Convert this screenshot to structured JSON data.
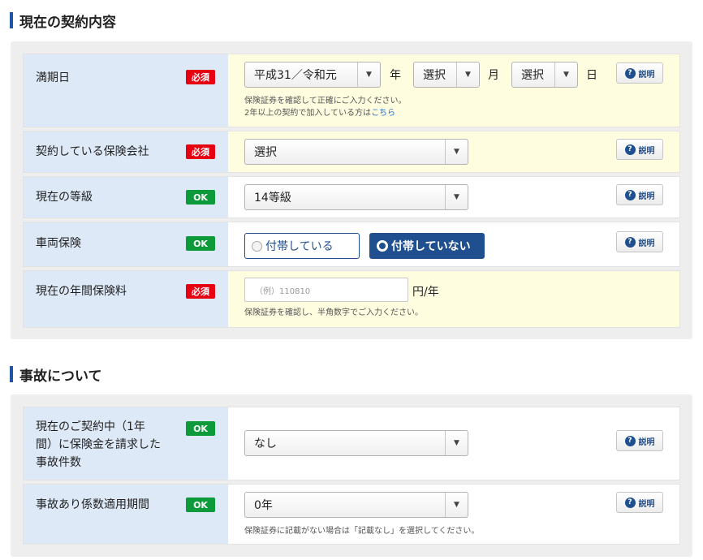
{
  "section1": {
    "title": "現在の契約内容",
    "rows": {
      "expiry": {
        "label": "満期日",
        "badge": "必須",
        "era_select": "平成31／令和元",
        "year_unit": "年",
        "month_select": "選択",
        "month_unit": "月",
        "day_select": "選択",
        "day_unit": "日",
        "note_line1": "保険証券を確認して正確にご入力ください。",
        "note_line2_prefix": "2年以上の契約で加入している方は",
        "note_line2_link": "こちら"
      },
      "insurer": {
        "label": "契約している保険会社",
        "badge": "必須",
        "select": "選択"
      },
      "grade": {
        "label": "現在の等級",
        "badge": "OK",
        "select": "14等級"
      },
      "vehicle": {
        "label": "車両保険",
        "badge": "OK",
        "option_off": "付帯している",
        "option_on": "付帯していない"
      },
      "premium": {
        "label": "現在の年間保険料",
        "badge": "必須",
        "placeholder": "（例）110810",
        "unit": "円/年",
        "note": "保険証券を確認し、半角数字でご入力ください。"
      }
    }
  },
  "section2": {
    "title": "事故について",
    "rows": {
      "claims": {
        "label_line1": "現在のご契約中（1年",
        "label_line2": "間）に保険金を請求した",
        "label_line3": "事故件数",
        "badge": "OK",
        "select": "なし"
      },
      "period": {
        "label": "事故あり係数適用期間",
        "badge": "OK",
        "select": "0年",
        "note": "保険証券に記載がない場合は「記載なし」を選択してください。"
      }
    }
  },
  "help_label": "説明",
  "help_icon": "question-icon",
  "dropdown_icon": "caret-down-icon"
}
